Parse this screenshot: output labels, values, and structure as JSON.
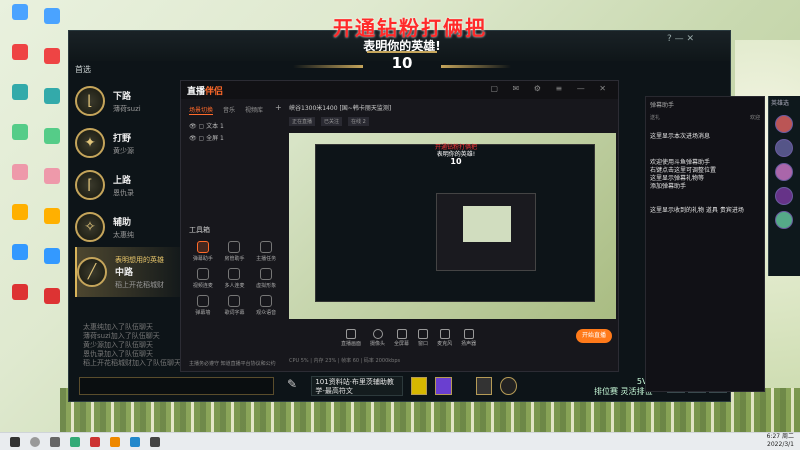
{
  "overlay": {
    "red_text": "开通钻粉打俩把"
  },
  "game": {
    "title": "表明你的英雄!",
    "timer": "10",
    "first_pick": "首选",
    "roles": [
      {
        "name": "下路",
        "user": "薄荷suzi",
        "icon": "bot-lane-icon"
      },
      {
        "name": "打野",
        "user": "黄少源",
        "icon": "jungle-icon"
      },
      {
        "name": "上路",
        "user": "恩仇录",
        "icon": "top-lane-icon"
      },
      {
        "name": "辅助",
        "user": "太惠纯",
        "icon": "support-icon"
      },
      {
        "name": "中路",
        "user": "稻上开花稻城财",
        "hint": "表明想用的英雄",
        "icon": "mid-lane-icon"
      }
    ],
    "chat_log": [
      "太惠纯加入了队伍聊天",
      "薄荷suzi加入了队伍聊天",
      "黄少源加入了队伍聊天",
      "恩仇录加入了队伍聊天",
      "稻上开花稻城财加入了队伍聊天"
    ],
    "spell_text": "101资料站·布里茨辅助教学-最高符文",
    "queue": {
      "rank": "5V5",
      "mode": "排位赛 灵活排位"
    },
    "win_ctrl": "?  —  ✕"
  },
  "team_panel": {
    "title": "英雄选"
  },
  "stream": {
    "logo_a": "直播",
    "logo_b": "伴侣",
    "tabs": [
      "场景切换",
      "音乐",
      "视频库"
    ],
    "plus": "+",
    "scenes": [
      "文本 1",
      "全屏 1"
    ],
    "header": "峡谷1300米1400 [国~韩卡丽天监测]",
    "row2": [
      "正在直播",
      "已关注",
      "在线 2"
    ],
    "tool_header": "工具箱",
    "tools": [
      "弹幕助手",
      "房管助手",
      "主播任务",
      "视频连麦",
      "多人连麦",
      "虚拟形象",
      "弹幕墙",
      "歌词字幕",
      "观众语音"
    ],
    "foot": "主播务必遵守 知道直播平台协议和公约",
    "bottom": [
      "直播画面",
      "摄像头",
      "全屏幕",
      "窗口",
      "麦克风",
      "扬声器"
    ],
    "go_live": "开始直播",
    "status": "CPU 5% | 内存 23% | 帧率 60 | 码率 2000kbps"
  },
  "danmu": {
    "title": "弹幕助手",
    "sub_left": "送礼",
    "sub_right": "欢迎",
    "lines": [
      "这里显示本次进场消息",
      "欢迎使用斗鱼弹幕助手",
      "右键点击这里可调整位置",
      "这里显示弹幕礼物等",
      "添加弹幕助手",
      "这里显示收到的礼物 道具 贵宾进场"
    ]
  },
  "desktop_icons": [
    {
      "label": "",
      "color": "#4aa3ff"
    },
    {
      "label": "",
      "color": "#e44"
    },
    {
      "label": "",
      "color": "#3aa"
    },
    {
      "label": "",
      "color": "#5c8"
    },
    {
      "label": "",
      "color": "#e9a"
    },
    {
      "label": "",
      "color": "#ffb000"
    },
    {
      "label": "",
      "color": "#39f"
    },
    {
      "label": "",
      "color": "#d33"
    }
  ],
  "taskbar": {
    "time": "6:27 周二",
    "date": "2022/3/1"
  }
}
